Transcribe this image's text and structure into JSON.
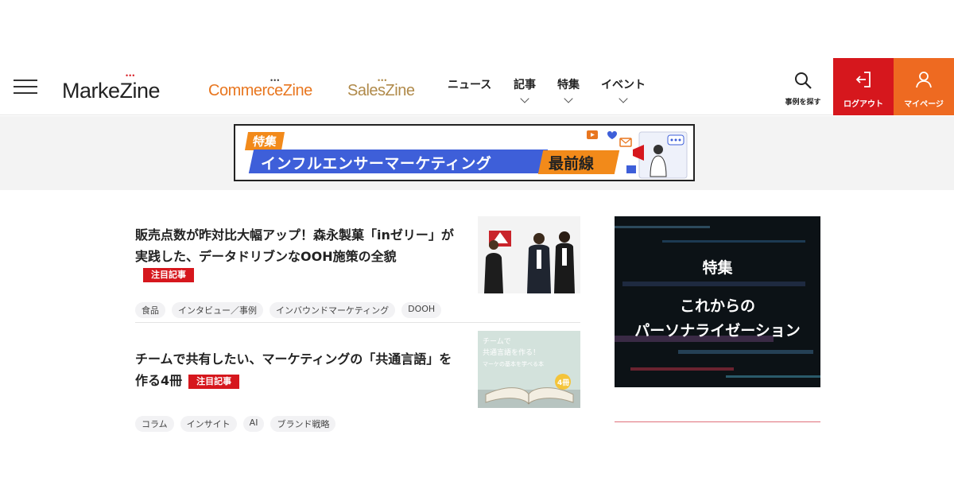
{
  "header": {
    "logos": {
      "main": "MarkeZine",
      "commerce": "CommerceZine",
      "sales": "SalesZine"
    },
    "nav": [
      {
        "label": "ニュース",
        "has_dropdown": false
      },
      {
        "label": "記事",
        "has_dropdown": true
      },
      {
        "label": "特集",
        "has_dropdown": true
      },
      {
        "label": "イベント",
        "has_dropdown": true
      }
    ],
    "search_label": "事例を探す",
    "logout_label": "ログアウト",
    "mypage_label": "マイページ",
    "colors": {
      "logout": "#d6171d",
      "mypage": "#ee6a21"
    }
  },
  "banner": {
    "tag": "特集",
    "title": "インフルエンサーマーケティング",
    "subtitle": "最前線"
  },
  "articles": [
    {
      "title": "販売点数が昨対比大幅アップ！森永製菓「inゼリー」が実践した、データドリブンなOOH施策の全貌",
      "badge": "注目記事",
      "tags": [
        "食品",
        "インタビュー／事例",
        "インバウンドマーケティング",
        "DOOH"
      ]
    },
    {
      "title": "チームで共有したい、マーケティングの「共通言語」を作る4冊",
      "badge": "注目記事",
      "tags": [
        "コラム",
        "インサイト",
        "AI",
        "ブランド戦略"
      ],
      "thumb_text": [
        "チームで",
        "共通言語を作る！",
        "マーケの基本を学べる本",
        "4冊"
      ]
    }
  ],
  "feature": {
    "label": "特集",
    "title_line1": "これからの",
    "title_line2": "パーソナライゼーション"
  }
}
